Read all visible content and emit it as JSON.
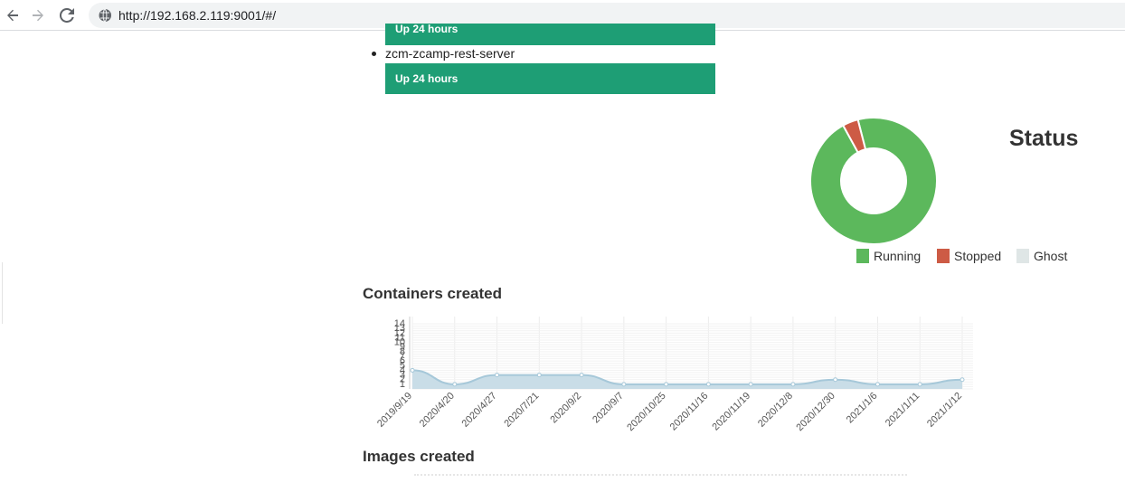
{
  "browser": {
    "url": "http://192.168.2.119:9001/#/"
  },
  "containers": {
    "items": [
      {
        "name": "",
        "status": "Up 24 hours"
      },
      {
        "name": "zcm-zcamp-rest-server",
        "status": "Up 24 hours"
      }
    ]
  },
  "status": {
    "title": "Status",
    "legend": [
      {
        "label": "Running",
        "color": "#5cb85c"
      },
      {
        "label": "Stopped",
        "color": "#cd5b45"
      },
      {
        "label": "Ghost",
        "color": "#dfe6e6"
      }
    ]
  },
  "containers_created": {
    "heading": "Containers created"
  },
  "images_created": {
    "heading": "Images created"
  },
  "chart_data": [
    {
      "type": "pie",
      "title": "Status",
      "donut": true,
      "labels": [
        "Running",
        "Stopped",
        "Ghost"
      ],
      "values": [
        96,
        4,
        0
      ],
      "colors": [
        "#5cb85c",
        "#cd5b45",
        "#dfe6e6"
      ]
    },
    {
      "type": "area",
      "title": "Containers created",
      "categories": [
        "2019/9/19",
        "2020/4/20",
        "2020/4/27",
        "2020/7/21",
        "2020/9/2",
        "2020/9/7",
        "2020/10/25",
        "2020/11/16",
        "2020/11/19",
        "2020/12/8",
        "2020/12/30",
        "2021/1/6",
        "2021/1/11",
        "2021/1/12"
      ],
      "values": [
        4,
        1,
        3,
        3,
        3,
        1,
        1,
        1,
        1,
        1,
        2,
        1,
        1,
        2
      ],
      "yticks": [
        1,
        2,
        3,
        4,
        5,
        6,
        7,
        8,
        9,
        10,
        11,
        12,
        13,
        14
      ],
      "ylim": [
        0,
        14
      ],
      "color": "#a6c8d9"
    }
  ]
}
